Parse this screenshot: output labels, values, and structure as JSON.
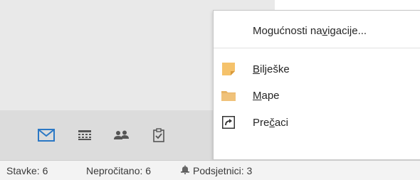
{
  "nav_bar": {
    "items": [
      {
        "id": "mail",
        "icon": "mail-icon",
        "color": "#2b78c5",
        "active": true
      },
      {
        "id": "calendar",
        "icon": "calendar-icon"
      },
      {
        "id": "people",
        "icon": "people-icon"
      },
      {
        "id": "tasks",
        "icon": "tasks-icon"
      },
      {
        "id": "more",
        "icon": "more-icon",
        "label": "•••"
      }
    ]
  },
  "menu": {
    "nav_options": {
      "pre": "Mogućnosti na",
      "ul": "v",
      "post": "igacije..."
    },
    "notes": {
      "pre": "",
      "ul": "B",
      "post": "ilješke",
      "icon": "notes-icon",
      "icon_color": "#f5c26b"
    },
    "folders": {
      "pre": "",
      "ul": "M",
      "post": "ape",
      "icon": "folder-icon",
      "icon_color": "#f0c27a"
    },
    "shortcuts": {
      "pre": "Pre",
      "ul": "č",
      "post": "aci",
      "icon": "shortcut-icon"
    }
  },
  "status_bar": {
    "items": "Stavke: 6",
    "unread": "Nepročitano: 6",
    "reminders": "Podsjetnici: 3"
  },
  "colors": {
    "accent": "#2b78c5",
    "nav_bg": "#dcdcdc",
    "pane_bg": "#e9e9e9",
    "status_bg": "#f3f3f3"
  }
}
